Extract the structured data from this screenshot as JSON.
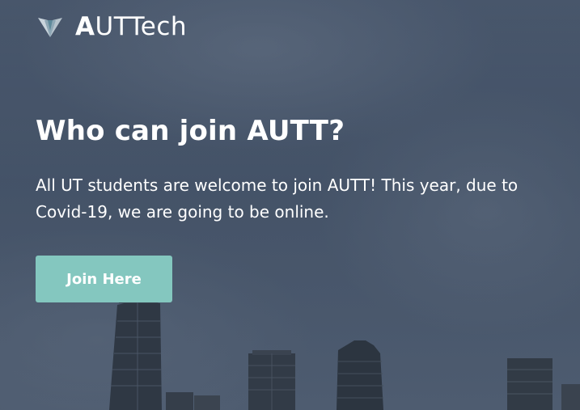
{
  "brand": {
    "first_letter": "A",
    "rest": "UTTech",
    "logo_icon": "winged-shield-icon"
  },
  "hero": {
    "title": "Who can join AUTT?",
    "description": "All UT students are welcome to join AUTT! This year, due to Covid-19, we are going to be online.",
    "cta_label": "Join Here"
  },
  "colors": {
    "button": "#84c7bf",
    "text": "#ffffff"
  }
}
